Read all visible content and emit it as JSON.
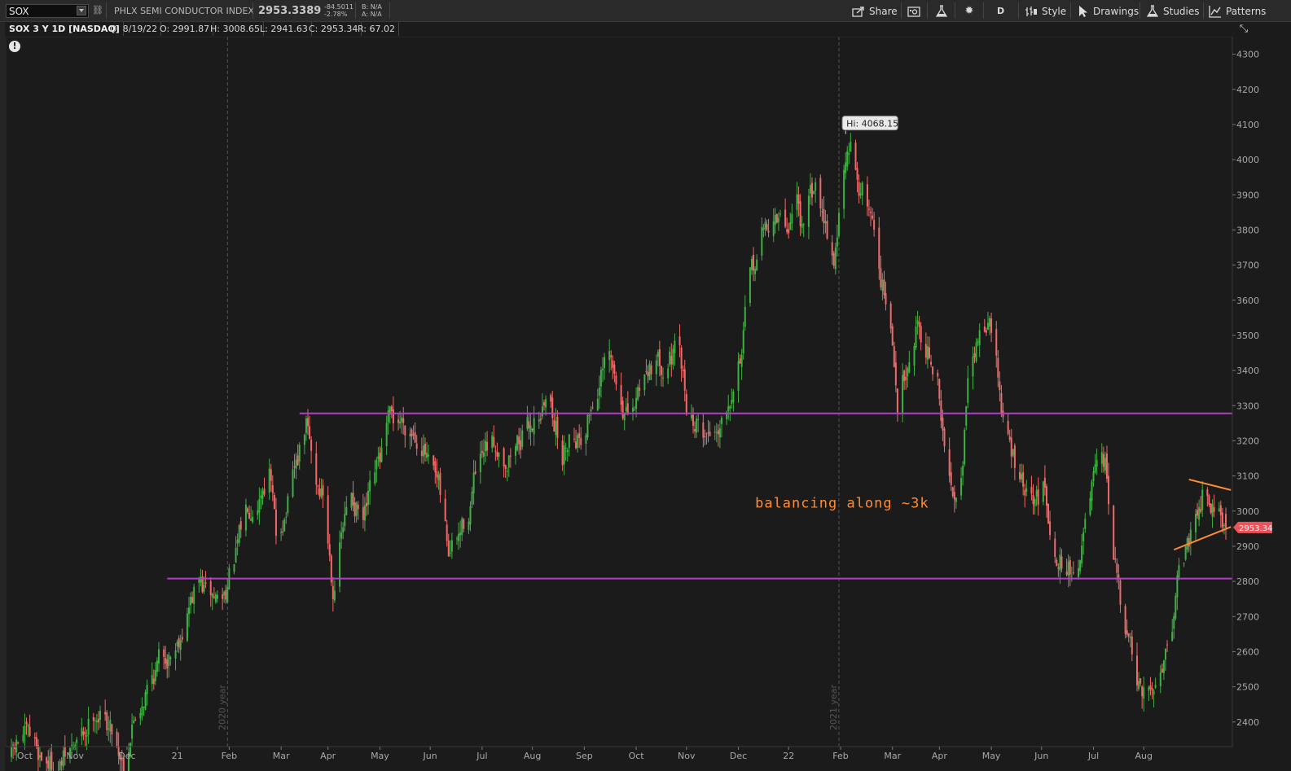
{
  "toolbar": {
    "symbol": "SOX",
    "description": "PHLX SEMI CONDUCTOR INDEX",
    "last_price": "2953.3389",
    "net_change": "-84.5011",
    "net_change_pct": "-2.78%",
    "bid": "B: N/A",
    "ask": "A: N/A",
    "share_label": "Share",
    "aggregation_label": "D",
    "style_label": "Style",
    "drawings_label": "Drawings",
    "studies_label": "Studies",
    "patterns_label": "Patterns"
  },
  "infobar": {
    "study": "SOX 3 Y 1D [NASDAQ]",
    "date": "D: 8/19/22",
    "open": "O: 2991.87",
    "high": "H: 3008.65",
    "low": "L: 2941.63",
    "close": "C: 2953.34",
    "range": "R: 67.02"
  },
  "chart_data": {
    "type": "candlestick",
    "title": "",
    "price_axis": {
      "ticks": [
        2400,
        2500,
        2600,
        2700,
        2800,
        2900,
        3000,
        3100,
        3200,
        3300,
        3400,
        3500,
        3600,
        3700,
        3800,
        3900,
        4000,
        4100,
        4200,
        4300
      ],
      "range": [
        2330,
        4350
      ],
      "position": "right"
    },
    "time_axis": {
      "labels": [
        "Sep",
        "Oct",
        "Nov",
        "Dec",
        "21",
        "Feb",
        "Mar",
        "Apr",
        "May",
        "Jun",
        "Jul",
        "Aug",
        "Sep",
        "Oct",
        "Nov",
        "Dec",
        "22",
        "Feb",
        "Mar",
        "Apr",
        "May",
        "Jun",
        "Jul",
        "Aug"
      ],
      "start": "2020-08-24",
      "end": "2022-08-19"
    },
    "year_markers": [
      {
        "date": "2020-12-31",
        "label": "2020 year"
      },
      {
        "date": "2021-12-31",
        "label": "2021 year"
      }
    ],
    "series": [
      {
        "name": "SOX",
        "close_path": [
          [
            "2020-08-24",
            2300
          ],
          [
            "2020-08-31",
            2360
          ],
          [
            "2020-09-10",
            2310
          ],
          [
            "2020-09-21",
            2270
          ],
          [
            "2020-10-06",
            2360
          ],
          [
            "2020-10-13",
            2440
          ],
          [
            "2020-10-23",
            2380
          ],
          [
            "2020-10-30",
            2290
          ],
          [
            "2020-11-05",
            2410
          ],
          [
            "2020-11-10",
            2470
          ],
          [
            "2020-11-20",
            2570
          ],
          [
            "2020-11-30",
            2620
          ],
          [
            "2020-12-08",
            2730
          ],
          [
            "2020-12-14",
            2800
          ],
          [
            "2020-12-18",
            2760
          ],
          [
            "2020-12-28",
            2750
          ],
          [
            "2021-01-05",
            2870
          ],
          [
            "2021-01-12",
            3020
          ],
          [
            "2021-01-19",
            3060
          ],
          [
            "2021-01-25",
            3120
          ],
          [
            "2021-01-29",
            2920
          ],
          [
            "2021-02-05",
            3020
          ],
          [
            "2021-02-10",
            3120
          ],
          [
            "2021-02-16",
            3240
          ],
          [
            "2021-02-22",
            3080
          ],
          [
            "2021-02-26",
            3050
          ],
          [
            "2021-03-04",
            2790
          ],
          [
            "2021-03-09",
            2930
          ],
          [
            "2021-03-15",
            3050
          ],
          [
            "2021-03-22",
            2960
          ],
          [
            "2021-03-26",
            3030
          ],
          [
            "2021-03-31",
            3120
          ],
          [
            "2021-04-06",
            3240
          ],
          [
            "2021-04-13",
            3260
          ],
          [
            "2021-04-20",
            3240
          ],
          [
            "2021-04-26",
            3210
          ],
          [
            "2021-04-30",
            3120
          ],
          [
            "2021-05-06",
            3050
          ],
          [
            "2021-05-12",
            2880
          ],
          [
            "2021-05-18",
            2920
          ],
          [
            "2021-05-24",
            3000
          ],
          [
            "2021-05-28",
            3100
          ],
          [
            "2021-06-04",
            3160
          ],
          [
            "2021-06-10",
            3190
          ],
          [
            "2021-06-16",
            3150
          ],
          [
            "2021-06-22",
            3200
          ],
          [
            "2021-06-28",
            3230
          ],
          [
            "2021-07-06",
            3290
          ],
          [
            "2021-07-12",
            3320
          ],
          [
            "2021-07-19",
            3150
          ],
          [
            "2021-07-23",
            3230
          ],
          [
            "2021-07-30",
            3220
          ],
          [
            "2021-08-05",
            3300
          ],
          [
            "2021-08-11",
            3380
          ],
          [
            "2021-08-16",
            3420
          ],
          [
            "2021-08-20",
            3350
          ],
          [
            "2021-08-26",
            3270
          ],
          [
            "2021-08-30",
            3260
          ],
          [
            "2021-09-03",
            3360
          ],
          [
            "2021-09-09",
            3430
          ],
          [
            "2021-09-15",
            3420
          ],
          [
            "2021-09-21",
            3450
          ],
          [
            "2021-09-27",
            3430
          ],
          [
            "2021-10-01",
            3300
          ],
          [
            "2021-10-06",
            3250
          ],
          [
            "2021-10-13",
            3220
          ],
          [
            "2021-10-19",
            3240
          ],
          [
            "2021-10-25",
            3320
          ],
          [
            "2021-10-29",
            3390
          ],
          [
            "2021-11-03",
            3470
          ],
          [
            "2021-11-08",
            3650
          ],
          [
            "2021-11-15",
            3780
          ],
          [
            "2021-11-22",
            3840
          ],
          [
            "2021-11-30",
            3800
          ],
          [
            "2021-12-06",
            3900
          ],
          [
            "2021-12-10",
            3780
          ],
          [
            "2021-12-16",
            3920
          ],
          [
            "2021-12-22",
            3860
          ],
          [
            "2021-12-28",
            3720
          ],
          [
            "2022-01-03",
            3960
          ],
          [
            "2022-01-07",
            4020
          ],
          [
            "2022-01-13",
            3920
          ],
          [
            "2022-01-19",
            3860
          ],
          [
            "2022-01-25",
            3680
          ],
          [
            "2022-01-31",
            3500
          ],
          [
            "2022-02-04",
            3300
          ],
          [
            "2022-02-10",
            3440
          ],
          [
            "2022-02-16",
            3550
          ],
          [
            "2022-02-22",
            3460
          ],
          [
            "2022-02-28",
            3360
          ],
          [
            "2022-03-04",
            3170
          ],
          [
            "2022-03-08",
            3050
          ],
          [
            "2022-03-14",
            3120
          ],
          [
            "2022-03-18",
            3350
          ],
          [
            "2022-03-24",
            3480
          ],
          [
            "2022-03-30",
            3560
          ],
          [
            "2022-04-04",
            3430
          ],
          [
            "2022-04-08",
            3250
          ],
          [
            "2022-04-14",
            3150
          ],
          [
            "2022-04-20",
            3060
          ],
          [
            "2022-04-26",
            3010
          ],
          [
            "2022-05-02",
            3060
          ],
          [
            "2022-05-06",
            2980
          ],
          [
            "2022-05-11",
            2870
          ],
          [
            "2022-05-16",
            2850
          ],
          [
            "2022-05-20",
            2820
          ],
          [
            "2022-05-25",
            2900
          ],
          [
            "2022-06-01",
            3080
          ],
          [
            "2022-06-08",
            3110
          ],
          [
            "2022-06-13",
            2890
          ],
          [
            "2022-06-17",
            2720
          ],
          [
            "2022-06-23",
            2600
          ],
          [
            "2022-06-30",
            2440
          ],
          [
            "2022-07-05",
            2480
          ],
          [
            "2022-07-11",
            2560
          ],
          [
            "2022-07-18",
            2700
          ],
          [
            "2022-07-22",
            2850
          ],
          [
            "2022-07-28",
            2920
          ],
          [
            "2022-08-03",
            3050
          ],
          [
            "2022-08-08",
            3070
          ],
          [
            "2022-08-12",
            3030
          ],
          [
            "2022-08-17",
            2990
          ],
          [
            "2022-08-19",
            2953
          ]
        ]
      }
    ],
    "high_marker": {
      "date": "2022-01-04",
      "value": 4068.15,
      "label": "Hi: 4068.15"
    },
    "last_price_label": {
      "value": 2953.34,
      "label": "2953.34"
    },
    "drawings": [
      {
        "type": "horizontal-line",
        "value": 3278,
        "from": "2021-02-12",
        "color": "#b040c8"
      },
      {
        "type": "horizontal-line",
        "value": 2808,
        "from": "2020-11-25",
        "color": "#b040c8"
      },
      {
        "type": "trendline",
        "from": [
          "2022-07-19",
          2890
        ],
        "to": [
          "2022-08-22",
          2955
        ],
        "color": "#ff8c33"
      },
      {
        "type": "trendline",
        "from": [
          "2022-07-28",
          3090
        ],
        "to": [
          "2022-08-22",
          3060
        ],
        "color": "#ff8c33"
      }
    ],
    "annotation": {
      "text": "balancing along ~3k",
      "date": "2021-11-11",
      "value": 3010,
      "color": "#ff8c33"
    },
    "colors": {
      "up": "#3fb044",
      "down": "#f06a6a",
      "background": "#1b1b1b",
      "grid_marker": "#555555"
    }
  }
}
